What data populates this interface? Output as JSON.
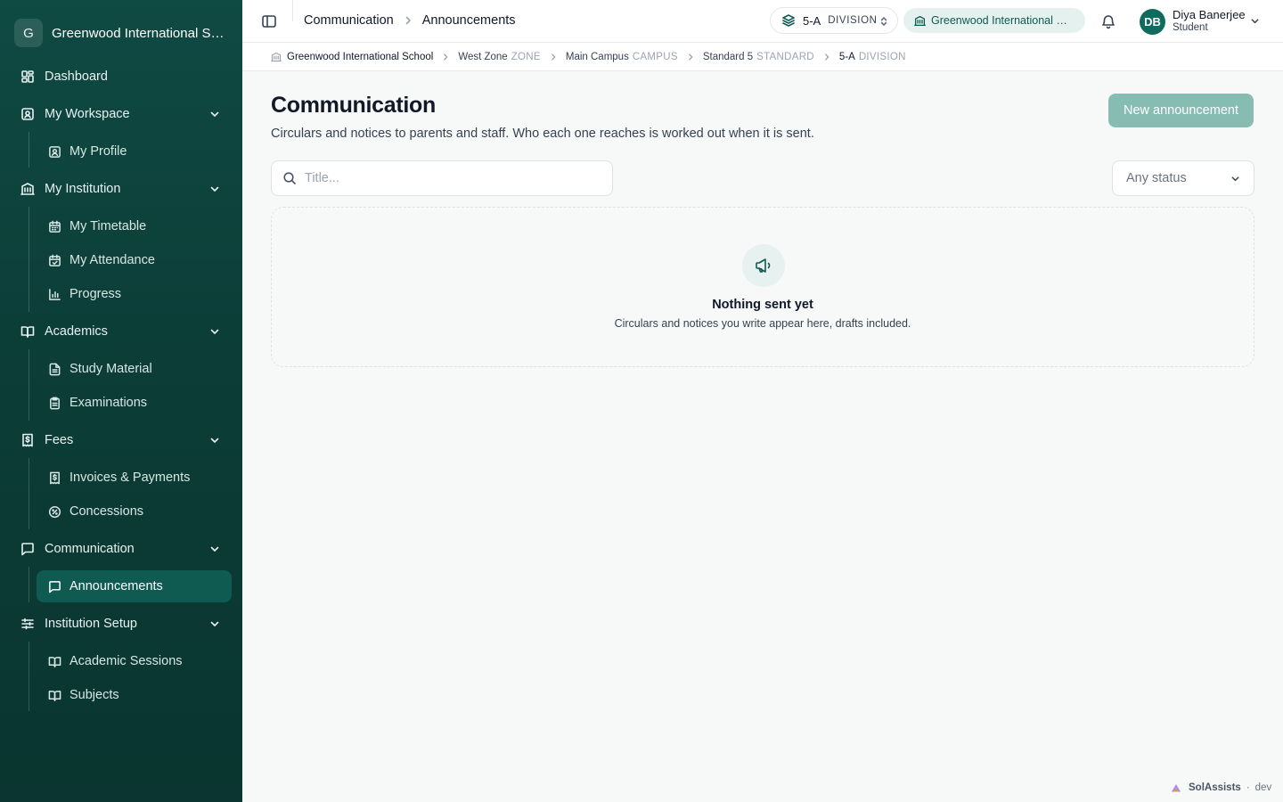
{
  "sidebar": {
    "brand_initial": "G",
    "brand_name": "Greenwood International School",
    "dashboard": "Dashboard",
    "workspace": {
      "label": "My Workspace",
      "items": [
        "My Profile"
      ]
    },
    "institution": {
      "label": "My Institution",
      "items": [
        "My Timetable",
        "My Attendance",
        "Progress"
      ]
    },
    "academics": {
      "label": "Academics",
      "items": [
        "Study Material",
        "Examinations"
      ]
    },
    "fees": {
      "label": "Fees",
      "items": [
        "Invoices & Payments",
        "Concessions"
      ]
    },
    "communication": {
      "label": "Communication",
      "items": [
        "Announcements"
      ]
    },
    "setup": {
      "label": "Institution Setup",
      "items": [
        "Academic Sessions",
        "Subjects"
      ]
    }
  },
  "topbar": {
    "crumb_parent": "Communication",
    "crumb_current": "Announcements",
    "division_value": "5-A",
    "division_type": "DIVISION",
    "school": "Greenwood International School",
    "user_initials": "DB",
    "user_name": "Diya Banerjee",
    "user_role": "Student"
  },
  "breadcrumb": [
    {
      "name": "Greenwood International School",
      "type": ""
    },
    {
      "name": "West Zone",
      "type": "ZONE"
    },
    {
      "name": "Main Campus",
      "type": "CAMPUS"
    },
    {
      "name": "Standard 5",
      "type": "STANDARD"
    },
    {
      "name": "5-A",
      "type": "DIVISION"
    }
  ],
  "main": {
    "title": "Communication",
    "subtitle": "Circulars and notices to parents and staff. Who each one reaches is worked out when it is sent.",
    "new_button": "New announcement",
    "search_placeholder": "Title...",
    "status_value": "Any status",
    "empty_title": "Nothing sent yet",
    "empty_subtitle": "Circulars and notices you write appear here, drafts included."
  },
  "footer": {
    "brand": "SolAssists",
    "env": "dev"
  },
  "colors": {
    "sidebar": "#0f4a43",
    "accent": "#0f5a51",
    "button_disabled": "#86bcb2"
  }
}
